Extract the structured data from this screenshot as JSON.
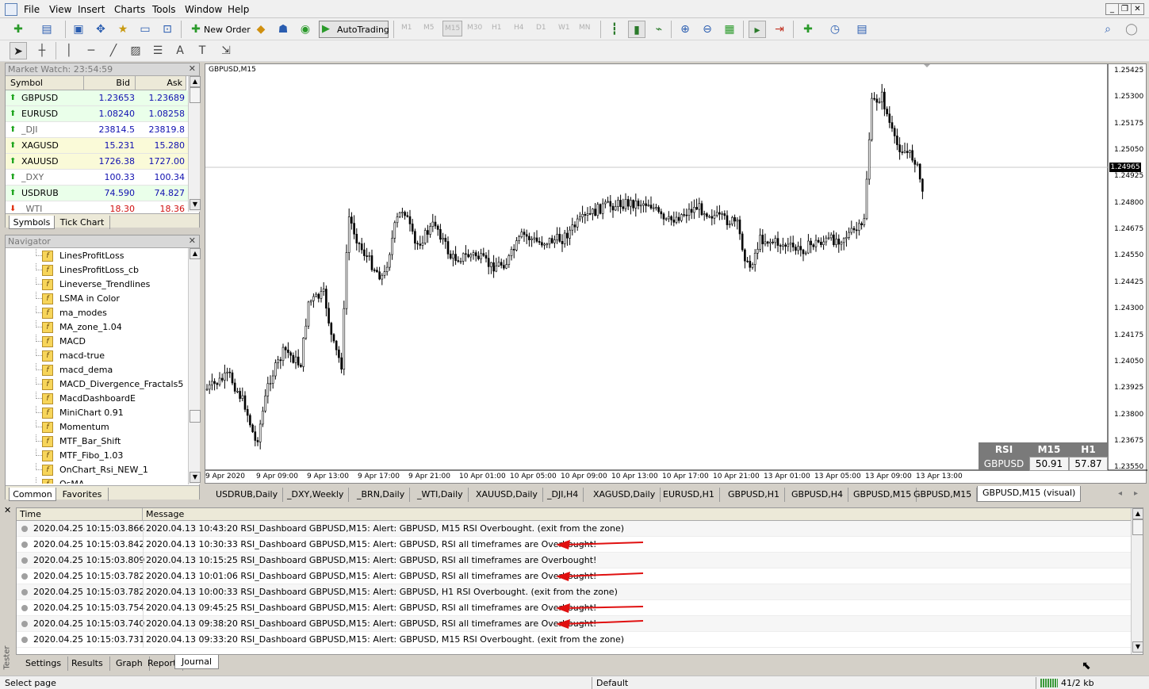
{
  "menu": [
    "File",
    "View",
    "Insert",
    "Charts",
    "Tools",
    "Window",
    "Help"
  ],
  "toolbar": {
    "new_order": "New Order",
    "autotrading": "AutoTrading",
    "timeframes": [
      "M1",
      "M5",
      "M15",
      "M30",
      "H1",
      "H4",
      "D1",
      "W1",
      "MN"
    ]
  },
  "market_watch": {
    "title": "Market Watch: 23:54:59",
    "columns": [
      "Symbol",
      "Bid",
      "Ask"
    ],
    "rows": [
      {
        "symbol": "GBPUSD",
        "bid": "1.23653",
        "ask": "1.23689",
        "dir": "up"
      },
      {
        "symbol": "EURUSD",
        "bid": "1.08240",
        "ask": "1.08258",
        "dir": "up"
      },
      {
        "symbol": "_DJI",
        "bid": "23814.5",
        "ask": "23819.8",
        "dir": "up"
      },
      {
        "symbol": "XAGUSD",
        "bid": "15.231",
        "ask": "15.280",
        "dir": "up"
      },
      {
        "symbol": "XAUUSD",
        "bid": "1726.38",
        "ask": "1727.00",
        "dir": "up"
      },
      {
        "symbol": "_DXY",
        "bid": "100.33",
        "ask": "100.34",
        "dir": "up"
      },
      {
        "symbol": "USDRUB",
        "bid": "74.590",
        "ask": "74.827",
        "dir": "up"
      },
      {
        "symbol": "_WTI",
        "bid": "18.30",
        "ask": "18.36",
        "dir": "down"
      }
    ],
    "tabs": [
      "Symbols",
      "Tick Chart"
    ]
  },
  "navigator": {
    "title": "Navigator",
    "items": [
      "LinesProfitLoss",
      "LinesProfitLoss_cb",
      "Lineverse_Trendlines",
      "LSMA in Color",
      "ma_modes",
      "MA_zone_1.04",
      "MACD",
      "macd-true",
      "macd_dema",
      "MACD_Divergence_Fractals5",
      "MacdDashboardE",
      "MiniChart 0.91",
      "Momentum",
      "MTF_Bar_Shift",
      "MTF_Fibo_1.03",
      "OnChart_Rsi_NEW_1",
      "OsMA"
    ],
    "tabs": [
      "Common",
      "Favorites"
    ]
  },
  "chart": {
    "title": "GBPUSD,M15",
    "current_price": "1.24965",
    "y_labels": [
      "1.25425",
      "1.25300",
      "1.25175",
      "1.25050",
      "1.24925",
      "1.24800",
      "1.24675",
      "1.24550",
      "1.24425",
      "1.24300",
      "1.24175",
      "1.24050",
      "1.23925",
      "1.23800",
      "1.23675",
      "1.23550"
    ],
    "x_labels": [
      "9 Apr 2020",
      "9 Apr 09:00",
      "9 Apr 13:00",
      "9 Apr 17:00",
      "9 Apr 21:00",
      "10 Apr 01:00",
      "10 Apr 05:00",
      "10 Apr 09:00",
      "10 Apr 13:00",
      "10 Apr 17:00",
      "10 Apr 21:00",
      "13 Apr 01:00",
      "13 Apr 05:00",
      "13 Apr 09:00",
      "13 Apr 13:00"
    ],
    "rsi_table": {
      "header": [
        "RSI",
        "M15",
        "H1"
      ],
      "row": [
        "GBPUSD",
        "50.91",
        "57.87"
      ]
    }
  },
  "chart_tabs": [
    "USDRUB,Daily",
    "_DXY,Weekly",
    "_BRN,Daily",
    "_WTI,Daily",
    "XAUUSD,Daily",
    "_DJI,H4",
    "XAGUSD,Daily",
    "EURUSD,H1",
    "GBPUSD,H1",
    "GBPUSD,H4",
    "GBPUSD,M15",
    "GBPUSD,M15",
    "GBPUSD,M15 (visual)"
  ],
  "journal": {
    "columns": [
      "Time",
      "Message"
    ],
    "rows": [
      {
        "time": "2020.04.25 10:15:03.866",
        "msg": "2020.04.13 10:43:20  RSI_Dashboard GBPUSD,M15: Alert: GBPUSD, M15 RSI Overbought. (exit from the zone)",
        "arrow": false
      },
      {
        "time": "2020.04.25 10:15:03.842",
        "msg": "2020.04.13 10:30:33  RSI_Dashboard GBPUSD,M15: Alert: GBPUSD, RSI all timeframes are Overbought!",
        "arrow": true
      },
      {
        "time": "2020.04.25 10:15:03.809",
        "msg": "2020.04.13 10:15:25  RSI_Dashboard GBPUSD,M15: Alert: GBPUSD, RSI all timeframes are Overbought!",
        "arrow": false
      },
      {
        "time": "2020.04.25 10:15:03.782",
        "msg": "2020.04.13 10:01:06  RSI_Dashboard GBPUSD,M15: Alert: GBPUSD, RSI all timeframes are Overbought!",
        "arrow": true
      },
      {
        "time": "2020.04.25 10:15:03.782",
        "msg": "2020.04.13 10:00:33  RSI_Dashboard GBPUSD,M15: Alert: GBPUSD, H1 RSI Overbought. (exit from the zone)",
        "arrow": false
      },
      {
        "time": "2020.04.25 10:15:03.754",
        "msg": "2020.04.13 09:45:25  RSI_Dashboard GBPUSD,M15: Alert: GBPUSD, RSI all timeframes are Overbought!",
        "arrow": true
      },
      {
        "time": "2020.04.25 10:15:03.740",
        "msg": "2020.04.13 09:38:20  RSI_Dashboard GBPUSD,M15: Alert: GBPUSD, RSI all timeframes are Overbought!",
        "arrow": true
      },
      {
        "time": "2020.04.25 10:15:03.731",
        "msg": "2020.04.13 09:33:20  RSI_Dashboard GBPUSD,M15: Alert: GBPUSD, M15 RSI Overbought. (exit from the zone)",
        "arrow": false
      }
    ],
    "tabs": [
      "Settings",
      "Results",
      "Graph",
      "Report",
      "Journal"
    ],
    "side_label": "Tester"
  },
  "status": {
    "left": "Select page",
    "profile": "Default",
    "traffic": "41/2 kb"
  },
  "colors": {
    "up": "#1aa31a",
    "down": "#e03010",
    "arrow": "#e01010",
    "rsi_header": "#7a7a7a"
  }
}
